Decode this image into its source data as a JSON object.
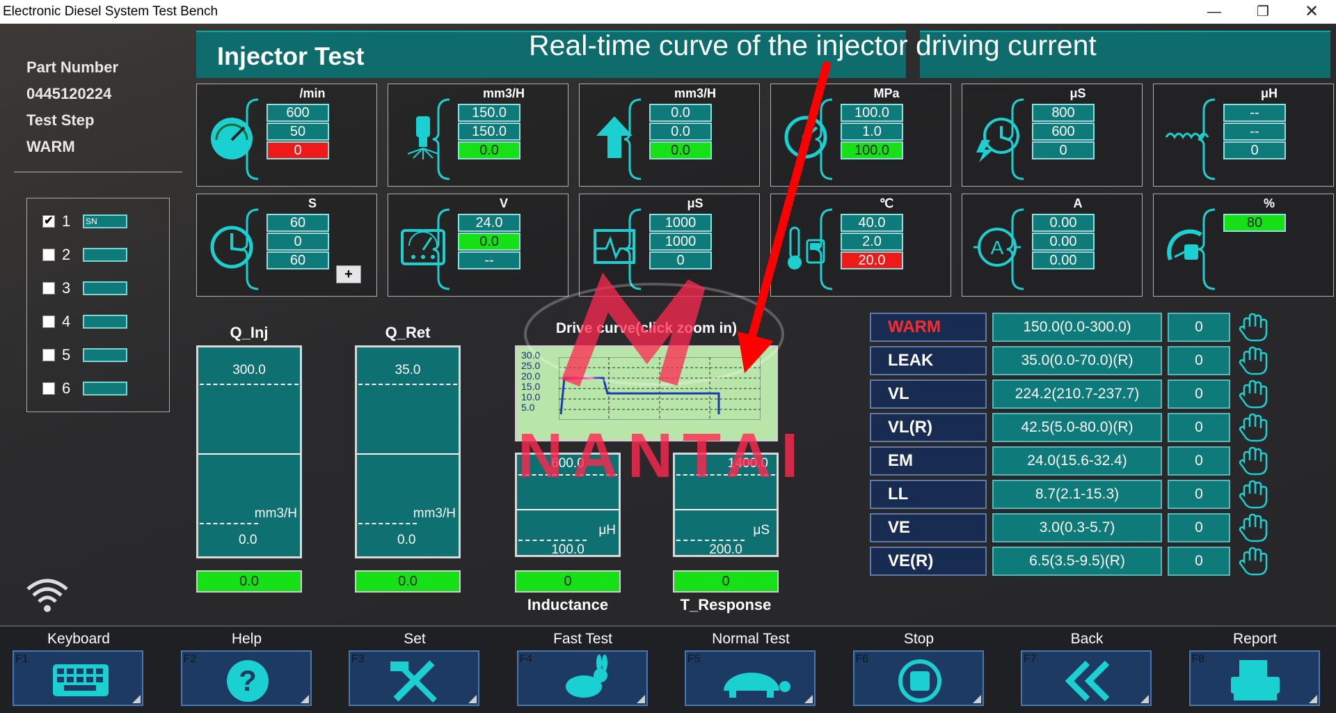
{
  "window": {
    "title": "Electronic Diesel System Test Bench"
  },
  "header": {
    "title": "Injector Test",
    "annotation": "Real-time curve of the injector driving current"
  },
  "left_info": {
    "part_number_label": "Part Number",
    "part_number": "0445120224",
    "test_step_label": "Test Step",
    "test_step": "WARM"
  },
  "sn_list": [
    {
      "num": "1",
      "checked": true,
      "field": "SN"
    },
    {
      "num": "2",
      "checked": false,
      "field": ""
    },
    {
      "num": "3",
      "checked": false,
      "field": ""
    },
    {
      "num": "4",
      "checked": false,
      "field": ""
    },
    {
      "num": "5",
      "checked": false,
      "field": ""
    },
    {
      "num": "6",
      "checked": false,
      "field": ""
    }
  ],
  "params_row1": [
    {
      "unit": "/min",
      "icon": "speedometer-icon",
      "values": [
        "600",
        "50",
        "0"
      ],
      "states": [
        "",
        "",
        "red"
      ]
    },
    {
      "unit": "mm3/H",
      "icon": "injector-spray-icon",
      "values": [
        "150.0",
        "150.0",
        "0.0"
      ],
      "states": [
        "",
        "",
        "green"
      ]
    },
    {
      "unit": "mm3/H",
      "icon": "return-arrow-icon",
      "values": [
        "0.0",
        "0.0",
        "0.0"
      ],
      "states": [
        "",
        "",
        "green"
      ]
    },
    {
      "unit": "MPa",
      "icon": "pressure-gauge-icon",
      "values": [
        "100.0",
        "1.0",
        "100.0"
      ],
      "states": [
        "",
        "",
        "green"
      ]
    },
    {
      "unit": "μS",
      "icon": "pulse-timer-icon",
      "values": [
        "800",
        "600",
        "0"
      ],
      "states": [
        "",
        "",
        ""
      ]
    },
    {
      "unit": "μH",
      "icon": "inductor-coil-icon",
      "values": [
        "--",
        "--",
        "0"
      ],
      "states": [
        "",
        "",
        ""
      ]
    }
  ],
  "params_row2": [
    {
      "unit": "S",
      "icon": "clock-icon",
      "values": [
        "60",
        "0",
        "60"
      ],
      "states": [
        "",
        "",
        ""
      ],
      "plus": "+"
    },
    {
      "unit": "V",
      "icon": "voltmeter-icon",
      "values": [
        "24.0",
        "0.0",
        "--"
      ],
      "states": [
        "",
        "green",
        ""
      ]
    },
    {
      "unit": "μS",
      "icon": "waveform-icon",
      "values": [
        "1000",
        "1000",
        "0"
      ],
      "states": [
        "",
        "",
        ""
      ]
    },
    {
      "unit": "℃",
      "icon": "thermometer-icon",
      "values": [
        "40.0",
        "2.0",
        "20.0"
      ],
      "states": [
        "",
        "",
        "red"
      ]
    },
    {
      "unit": "A",
      "icon": "ammeter-icon",
      "values": [
        "0.00",
        "0.00",
        "0.00"
      ],
      "states": [
        "",
        "",
        ""
      ]
    },
    {
      "unit": "%",
      "icon": "fuel-gauge-icon",
      "values": [
        "80"
      ],
      "states": [
        "green"
      ]
    }
  ],
  "gauges": {
    "q_inj": {
      "label": "Q_Inj",
      "max": "300.0",
      "min": "0.0",
      "unit": "mm3/H",
      "value": "0.0"
    },
    "q_ret": {
      "label": "Q_Ret",
      "max": "35.0",
      "min": "0.0",
      "unit": "mm3/H",
      "value": "0.0"
    },
    "inductance": {
      "label": "Inductance",
      "max": "600.0",
      "min": "100.0",
      "unit": "μH",
      "value": "0"
    },
    "t_response": {
      "label": "T_Response",
      "max": "1400.0",
      "min": "200.0",
      "unit": "μS",
      "value": "0"
    }
  },
  "drive_curve": {
    "title": "Drive curve(click zoom in)",
    "y_ticks": [
      "30.0",
      "25.0",
      "20.0",
      "15.0",
      "10.0",
      "5.0"
    ]
  },
  "watermark": "NANTAI",
  "results": [
    {
      "name": "WARM",
      "value": "150.0(0.0-300.0)",
      "count": "0",
      "active": true
    },
    {
      "name": "LEAK",
      "value": "35.0(0.0-70.0)(R)",
      "count": "0",
      "active": false
    },
    {
      "name": "VL",
      "value": "224.2(210.7-237.7)",
      "count": "0",
      "active": false
    },
    {
      "name": "VL(R)",
      "value": "42.5(5.0-80.0)(R)",
      "count": "0",
      "active": false
    },
    {
      "name": "EM",
      "value": "24.0(15.6-32.4)",
      "count": "0",
      "active": false
    },
    {
      "name": "LL",
      "value": "8.7(2.1-15.3)",
      "count": "0",
      "active": false
    },
    {
      "name": "VE",
      "value": "3.0(0.3-5.7)",
      "count": "0",
      "active": false
    },
    {
      "name": "VE(R)",
      "value": "6.5(3.5-9.5)(R)",
      "count": "0",
      "active": false
    }
  ],
  "function_keys": [
    {
      "label": "Keyboard",
      "fn": "F1",
      "icon": "keyboard-icon"
    },
    {
      "label": "Help",
      "fn": "F2",
      "icon": "help-icon"
    },
    {
      "label": "Set",
      "fn": "F3",
      "icon": "tools-icon"
    },
    {
      "label": "Fast Test",
      "fn": "F4",
      "icon": "rabbit-icon"
    },
    {
      "label": "Normal Test",
      "fn": "F5",
      "icon": "turtle-icon"
    },
    {
      "label": "Stop",
      "fn": "F6",
      "icon": "stop-icon"
    },
    {
      "label": "Back",
      "fn": "F7",
      "icon": "back-icon"
    },
    {
      "label": "Report",
      "fn": "F8",
      "icon": "printer-icon"
    }
  ],
  "colors": {
    "teal": "#0e7a7a",
    "green": "#16e016",
    "red": "#ee1a1a",
    "navy": "#182c52",
    "accent": "#1ad0d0",
    "annotation_arrow": "#ff0000"
  }
}
